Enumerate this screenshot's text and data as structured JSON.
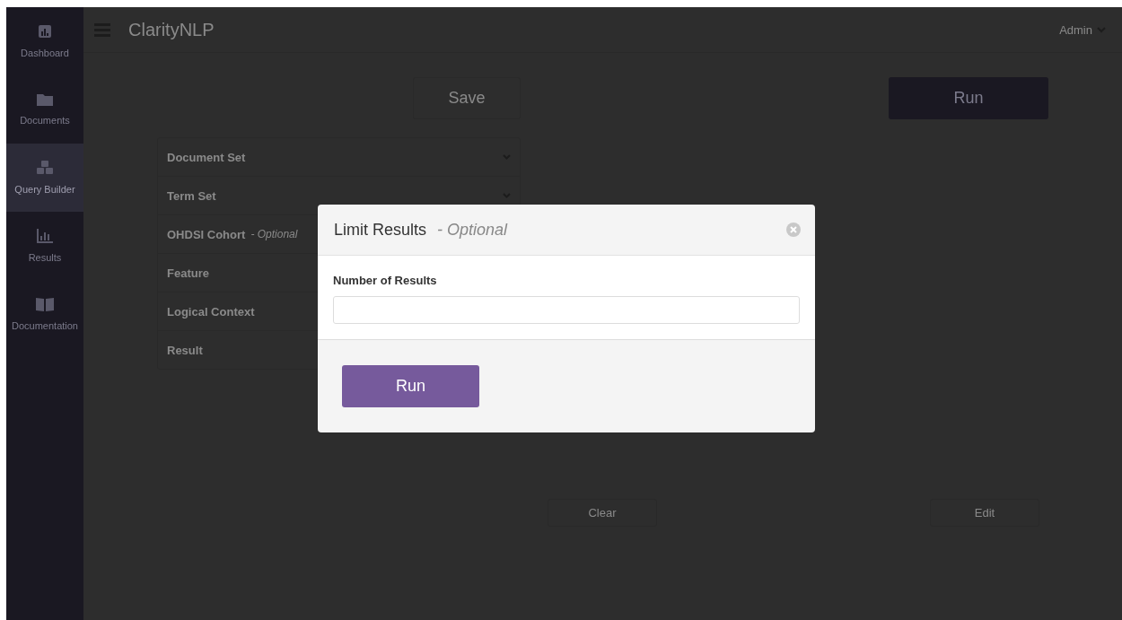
{
  "header": {
    "title": "ClarityNLP",
    "user": "Admin"
  },
  "sidebar": {
    "items": [
      {
        "label": "Dashboard",
        "selected": false
      },
      {
        "label": "Documents",
        "selected": false
      },
      {
        "label": "Query Builder",
        "selected": true
      },
      {
        "label": "Results",
        "selected": false
      },
      {
        "label": "Documentation",
        "selected": false
      }
    ]
  },
  "toolbar": {
    "save": "Save",
    "run": "Run"
  },
  "sections": [
    {
      "title": "Document Set"
    },
    {
      "title": "Term Set"
    },
    {
      "title": "OHDSI Cohort",
      "note": "- Optional"
    },
    {
      "title": "Feature"
    },
    {
      "title": "Logical Context"
    },
    {
      "title": "Result"
    }
  ],
  "bottom_buttons": [
    "Clear",
    "Edit"
  ],
  "modal": {
    "title": "Limit Results",
    "note": "- Optional",
    "field_label": "Number of Results",
    "button": "Run"
  }
}
